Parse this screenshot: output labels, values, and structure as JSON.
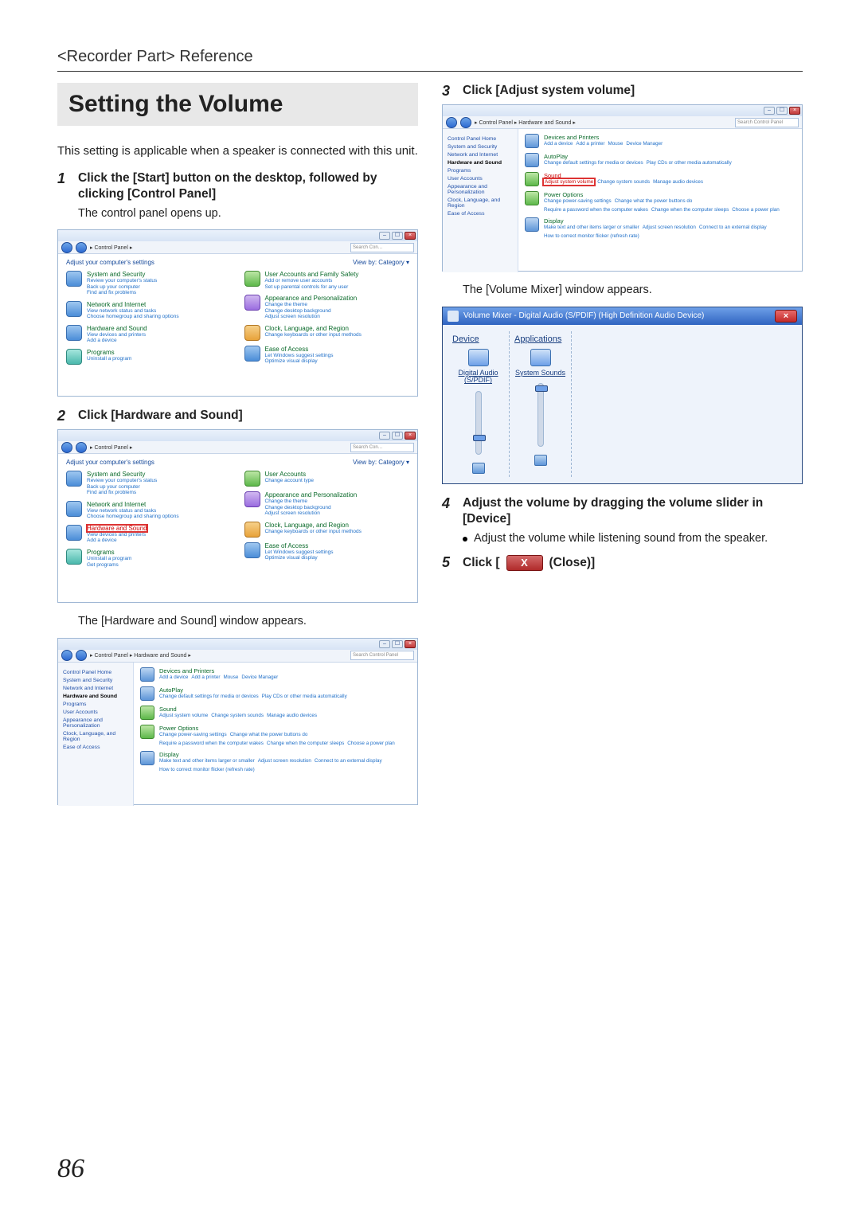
{
  "breadcrumb": "<Recorder Part> Reference",
  "title": "Setting the Volume",
  "intro": "This setting is applicable when a speaker is connected with this unit.",
  "pageNumber": "86",
  "steps": {
    "s1": {
      "num": "1",
      "text": "Click the [Start] button on the desktop, followed by clicking [Control Panel]",
      "sub": "The control panel opens up."
    },
    "s2": {
      "num": "2",
      "text": "Click [Hardware and Sound]",
      "sub": "The [Hardware and Sound] window appears."
    },
    "s3": {
      "num": "3",
      "text": "Click [Adjust system volume]",
      "sub": "The [Volume Mixer] window appears."
    },
    "s4": {
      "num": "4",
      "text": "Adjust the volume by dragging the volume slider in [Device]",
      "bullet": "Adjust the volume while listening sound from the speaker."
    },
    "s5": {
      "num": "5",
      "pre": "Click [",
      "post": " (Close)]",
      "x": "X"
    }
  },
  "cp": {
    "crumb": "▸ Control Panel ▸",
    "search": "Search Con…",
    "adjust": "Adjust your computer's settings",
    "viewby": "View by:   Category ▾",
    "items": {
      "sysSec": {
        "hd": "System and Security",
        "sub1": "Review your computer's status",
        "sub2": "Back up your computer",
        "sub3": "Find and fix problems"
      },
      "netInt": {
        "hd": "Network and Internet",
        "sub1": "View network status and tasks",
        "sub2": "Choose homegroup and sharing options"
      },
      "hwSnd": {
        "hd": "Hardware and Sound",
        "sub1": "View devices and printers",
        "sub2": "Add a device"
      },
      "prog": {
        "hd": "Programs",
        "sub1": "Uninstall a program"
      },
      "userAcc": {
        "hd": "User Accounts and Family Safety",
        "sub1": "Add or remove user accounts",
        "sub2": "Set up parental controls for any user"
      },
      "appPers": {
        "hd": "Appearance and Personalization",
        "sub1": "Change the theme",
        "sub2": "Change desktop background",
        "sub3": "Adjust screen resolution"
      },
      "clr": {
        "hd": "Clock, Language, and Region",
        "sub1": "Change keyboards or other input methods"
      },
      "eoa": {
        "hd": "Ease of Access",
        "sub1": "Let Windows suggest settings",
        "sub2": "Optimize visual display"
      },
      "userAcc2": {
        "hd": "User Accounts",
        "sub1": "Change account type"
      },
      "prog2": {
        "hd": "Programs",
        "sub1": "Uninstall a program",
        "sub2": "Get programs"
      }
    }
  },
  "hs": {
    "crumb": "▸ Control Panel ▸ Hardware and Sound ▸",
    "search": "Search Control Panel",
    "side": {
      "home": "Control Panel Home",
      "sysSec": "System and Security",
      "netInt": "Network and Internet",
      "hwSnd": "Hardware and Sound",
      "prog": "Programs",
      "userAcc": "User Accounts",
      "appPers": "Appearance and Personalization",
      "clr": "Clock, Language, and Region",
      "eoa": "Ease of Access"
    },
    "items": {
      "dev": {
        "hd": "Devices and Printers",
        "s1": "Add a device",
        "s2": "Add a printer",
        "s3": "Mouse",
        "s4": "Device Manager"
      },
      "auto": {
        "hd": "AutoPlay",
        "s1": "Change default settings for media or devices",
        "s2": "Play CDs or other media automatically"
      },
      "sound": {
        "hd": "Sound",
        "s1": "Adjust system volume",
        "s2": "Change system sounds",
        "s3": "Manage audio devices"
      },
      "power": {
        "hd": "Power Options",
        "s1": "Change power-saving settings",
        "s2": "Change what the power buttons do",
        "s3": "Require a password when the computer wakes",
        "s4": "Change when the computer sleeps",
        "s5": "Choose a power plan"
      },
      "disp": {
        "hd": "Display",
        "s1": "Make text and other items larger or smaller",
        "s2": "Adjust screen resolution",
        "s3": "Connect to an external display",
        "s4": "How to correct monitor flicker (refresh rate)"
      }
    }
  },
  "vm": {
    "title": "Volume Mixer - Digital Audio (S/PDIF) (High Definition Audio Device)",
    "deviceHead": "Device",
    "appsHead": "Applications",
    "device": "Digital Audio (S/PDIF)",
    "app1": "System Sounds"
  }
}
